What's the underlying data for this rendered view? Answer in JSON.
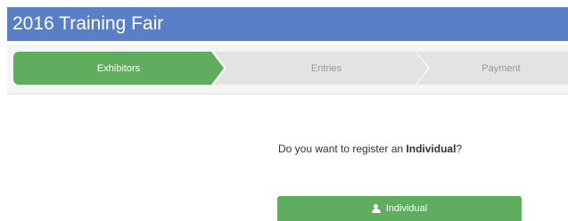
{
  "header": {
    "title": "2016 Training Fair"
  },
  "steps": [
    {
      "label": "Exhibitors",
      "active": true
    },
    {
      "label": "Entries",
      "active": false
    },
    {
      "label": "Payment",
      "active": false
    }
  ],
  "question": {
    "prefix": "Do you want to register an ",
    "emphasis": "Individual",
    "suffix": "?"
  },
  "actions": {
    "individual_label": "Individual",
    "individual_icon": "user-icon"
  },
  "colors": {
    "header": "#5a7fc6",
    "active_step": "#60ad60",
    "inactive_step": "#e3e3e3",
    "button": "#60ad60"
  }
}
